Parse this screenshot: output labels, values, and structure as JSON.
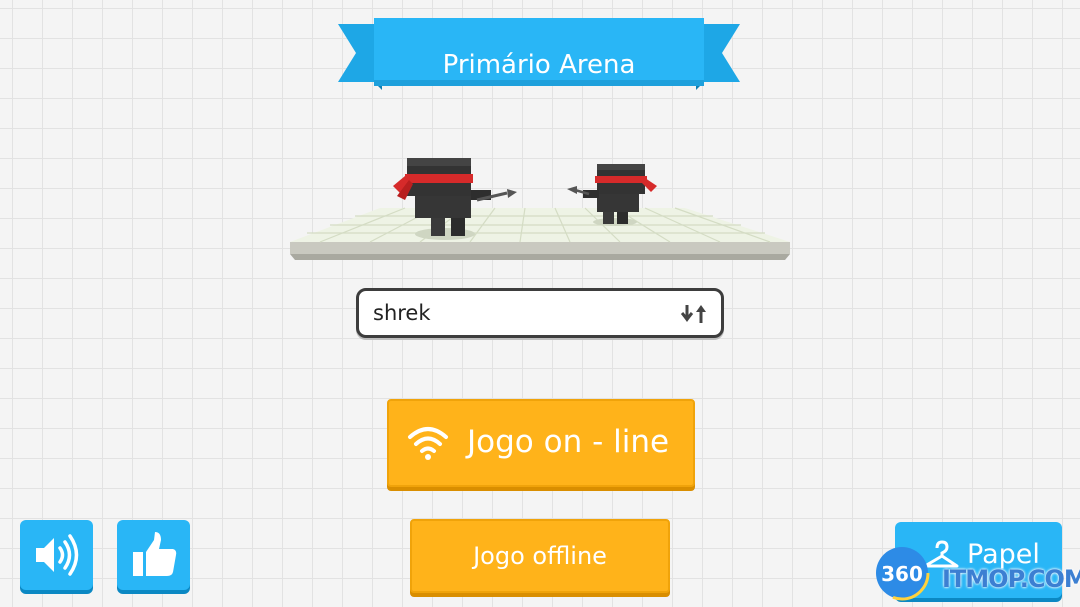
{
  "header": {
    "title": "Primário Arena"
  },
  "player": {
    "name": "shrek"
  },
  "buttons": {
    "online_label": "Jogo on - line",
    "offline_label": "Jogo offline",
    "role_label": "Papel"
  },
  "icons": {
    "shuffle": "shuffle-icon",
    "wifi": "wifi-icon",
    "sound": "speaker-icon",
    "like": "thumbs-up-icon",
    "role": "hanger-icon"
  },
  "watermark": {
    "badge": "360",
    "site": "ITMOP.COM"
  },
  "colors": {
    "banner": "#29b6f6",
    "orange_button": "#ffb31a",
    "blue_button": "#29b6f6",
    "bandana": "#d62a2a"
  }
}
